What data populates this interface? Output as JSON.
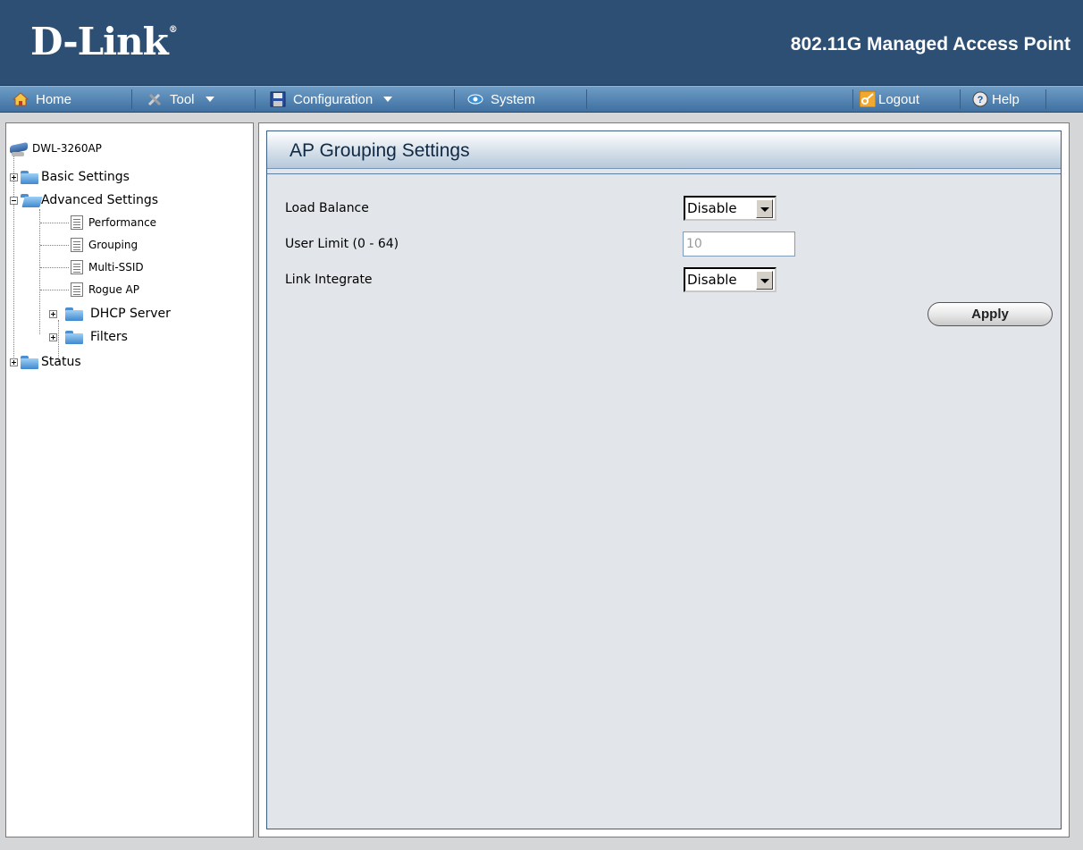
{
  "header": {
    "logo": "D-Link",
    "logo_mark": "®",
    "product": "802.11G Managed Access Point"
  },
  "menubar": {
    "home": "Home",
    "tool": "Tool",
    "configuration": "Configuration",
    "system": "System",
    "logout": "Logout",
    "help": "Help"
  },
  "sidebar": {
    "root": "DWL-3260AP",
    "basic_settings": "Basic Settings",
    "advanced_settings": "Advanced Settings",
    "performance": "Performance",
    "grouping": "Grouping",
    "multi_ssid": "Multi-SSID",
    "rogue_ap": "Rogue AP",
    "dhcp_server": "DHCP Server",
    "filters": "Filters",
    "status": "Status"
  },
  "panel": {
    "title": "AP Grouping Settings",
    "load_balance_label": "Load Balance",
    "load_balance_value": "Disable",
    "user_limit_label": "User Limit (0 - 64)",
    "user_limit_value": "10",
    "link_integrate_label": "Link Integrate",
    "link_integrate_value": "Disable",
    "apply_label": "Apply"
  },
  "colors": {
    "header_bg": "#2e4f74",
    "menubar": "#4f80b0",
    "panel_bg": "#e2e6ea"
  }
}
